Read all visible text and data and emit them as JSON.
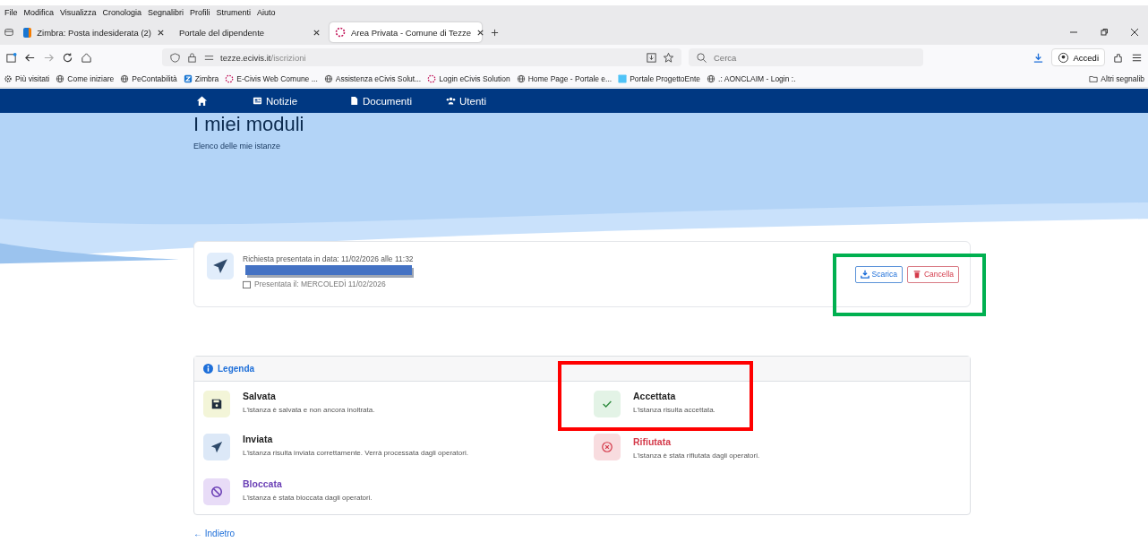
{
  "menu_bar": [
    "File",
    "Modifica",
    "Visualizza",
    "Cronologia",
    "Segnalibri",
    "Profili",
    "Strumenti",
    "Aiuto"
  ],
  "tabs": [
    {
      "label": "Zimbra: Posta indesiderata (2)",
      "kind": "zimbra",
      "selected": false
    },
    {
      "label": "Portale del dipendente",
      "kind": "plain",
      "selected": false
    },
    {
      "label": "Area Privata - Comune di Tezze",
      "kind": "ecivis",
      "selected": true
    }
  ],
  "address_bar": {
    "domain": "tezze.ecivis.it",
    "path": "/iscrizioni"
  },
  "search": {
    "placeholder": "Cerca"
  },
  "account_button": "Accedi",
  "bookmarks": [
    {
      "label": "Più visitati",
      "kind": "gear"
    },
    {
      "label": "Come iniziare",
      "kind": "globe"
    },
    {
      "label": "PeContabilità",
      "kind": "globe"
    },
    {
      "label": "Zimbra",
      "kind": "zimbra"
    },
    {
      "label": "E-Civis Web Comune ...",
      "kind": "ecivis"
    },
    {
      "label": "Assistenza eCivis Solut...",
      "kind": "globe"
    },
    {
      "label": "Login eCivis Solution",
      "kind": "ecivis"
    },
    {
      "label": "Home Page - Portale e...",
      "kind": "globe"
    },
    {
      "label": "Portale ProgettoEnte",
      "kind": "brand"
    },
    {
      "label": ".: AONCLAIM - Login :.",
      "kind": "globe"
    }
  ],
  "other_bookmarks": "Altri segnalib",
  "site_nav": [
    {
      "label": "Notizie",
      "kind": "news"
    },
    {
      "label": "Documenti",
      "kind": "document"
    },
    {
      "label": "Utenti",
      "kind": "users"
    }
  ],
  "page": {
    "title": "I miei moduli",
    "subtitle": "Elenco delle mie istanze"
  },
  "request": {
    "submitted": "Richiesta presentata in data: 11/02/2026 alle 11:32",
    "presented": "Presentata il: MERCOLEDÌ 11/02/2026",
    "buttons": [
      {
        "label": "Scarica",
        "kind": "download"
      },
      {
        "label": "Cancella",
        "kind": "delete"
      }
    ]
  },
  "legend": {
    "title": "Legenda",
    "items": [
      {
        "title": "Salvata",
        "description": "L'istanza è salvata e non ancora inoltrata.",
        "kind": "saved"
      },
      {
        "title": "Accettata",
        "description": "L'istanza risulta accettata.",
        "kind": "accepted"
      },
      {
        "title": "Inviata",
        "description": "L'istanza risulta inviata correttamente. Verrà processata dagli operatori.",
        "kind": "sent"
      },
      {
        "title": "Rifiutata",
        "description": "L'istanza è stata rifiutata dagli operatori.",
        "kind": "rejected"
      },
      {
        "title": "Bloccata",
        "description": "L'istanza è stata bloccata dagli operatori.",
        "kind": "blocked"
      }
    ]
  },
  "back_link": "← Indietro",
  "annotations": [
    {
      "color": "#00b050"
    },
    {
      "color": "#ff0000"
    }
  ]
}
